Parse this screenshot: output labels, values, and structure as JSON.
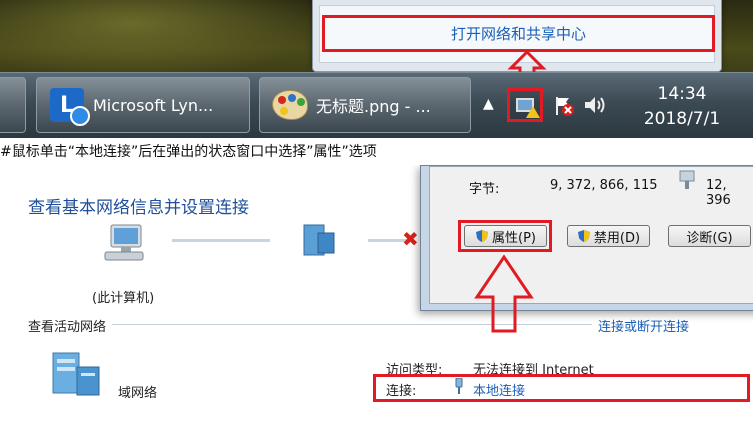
{
  "popup": {
    "link_label": "打开网络和共享中心"
  },
  "taskbar": {
    "apps": [
      {
        "label": "Microsoft Lyn..."
      },
      {
        "label": "无标题.png - ..."
      }
    ],
    "clock": {
      "time": "14:34",
      "date": "2018/7/1"
    },
    "tray_icons": [
      "show-hidden-icons-arrow",
      "network-warning-icon",
      "action-center-flag-icon",
      "volume-icon"
    ]
  },
  "caption": "#鼠标单击“本地连接”后在弹出的状态窗口中选择”属性”选项",
  "sharing_center": {
    "title": "查看基本网络信息并设置连接",
    "pc_label": "(此计算机)",
    "active_networks_title": "查看活动网络",
    "connect_disconnect_link": "连接或断开连接",
    "network_name": "域网络",
    "access_type_key": "访问类型:",
    "access_type_value": "无法连接到 Internet",
    "connection_key": "连接:",
    "connection_value": "本地连接"
  },
  "status_dialog": {
    "bytes_label": "字节:",
    "bytes_sent": "9, 372, 866, 115",
    "bytes_received": "12, 396",
    "buttons": {
      "properties": "属性(P)",
      "disable": "禁用(D)",
      "diagnose": "诊断(G)"
    }
  },
  "colors": {
    "highlight_red": "#e01b24",
    "link_blue": "#1c5fb8",
    "title_blue": "#1f4f9a"
  }
}
